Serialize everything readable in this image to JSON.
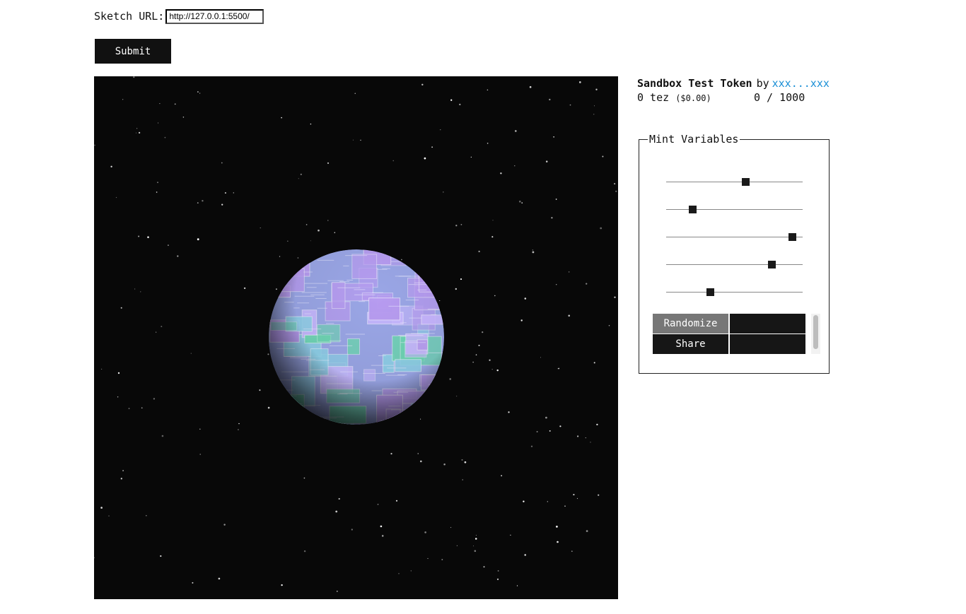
{
  "form": {
    "url_label": "Sketch URL:",
    "url_value": "http://127.0.0.1:5500/",
    "submit_label": "Submit"
  },
  "token": {
    "title": "Sandbox Test Token",
    "by_label": "by",
    "author": "xxx...xxx",
    "price": "0 tez",
    "price_usd": "($0.00)",
    "editions": "0 / 1000"
  },
  "mint": {
    "legend": "Mint Variables",
    "sliders": [
      {
        "value": 0.58
      },
      {
        "value": 0.19
      },
      {
        "value": 0.92
      },
      {
        "value": 0.77
      },
      {
        "value": 0.32
      }
    ],
    "randomize_label": "Randomize",
    "share_label": "Share"
  },
  "canvas": {
    "background": "#080808",
    "planet_colors": [
      "#b79cf0",
      "#8fd0e8",
      "#6fd6b4",
      "#c9b8ff"
    ]
  }
}
